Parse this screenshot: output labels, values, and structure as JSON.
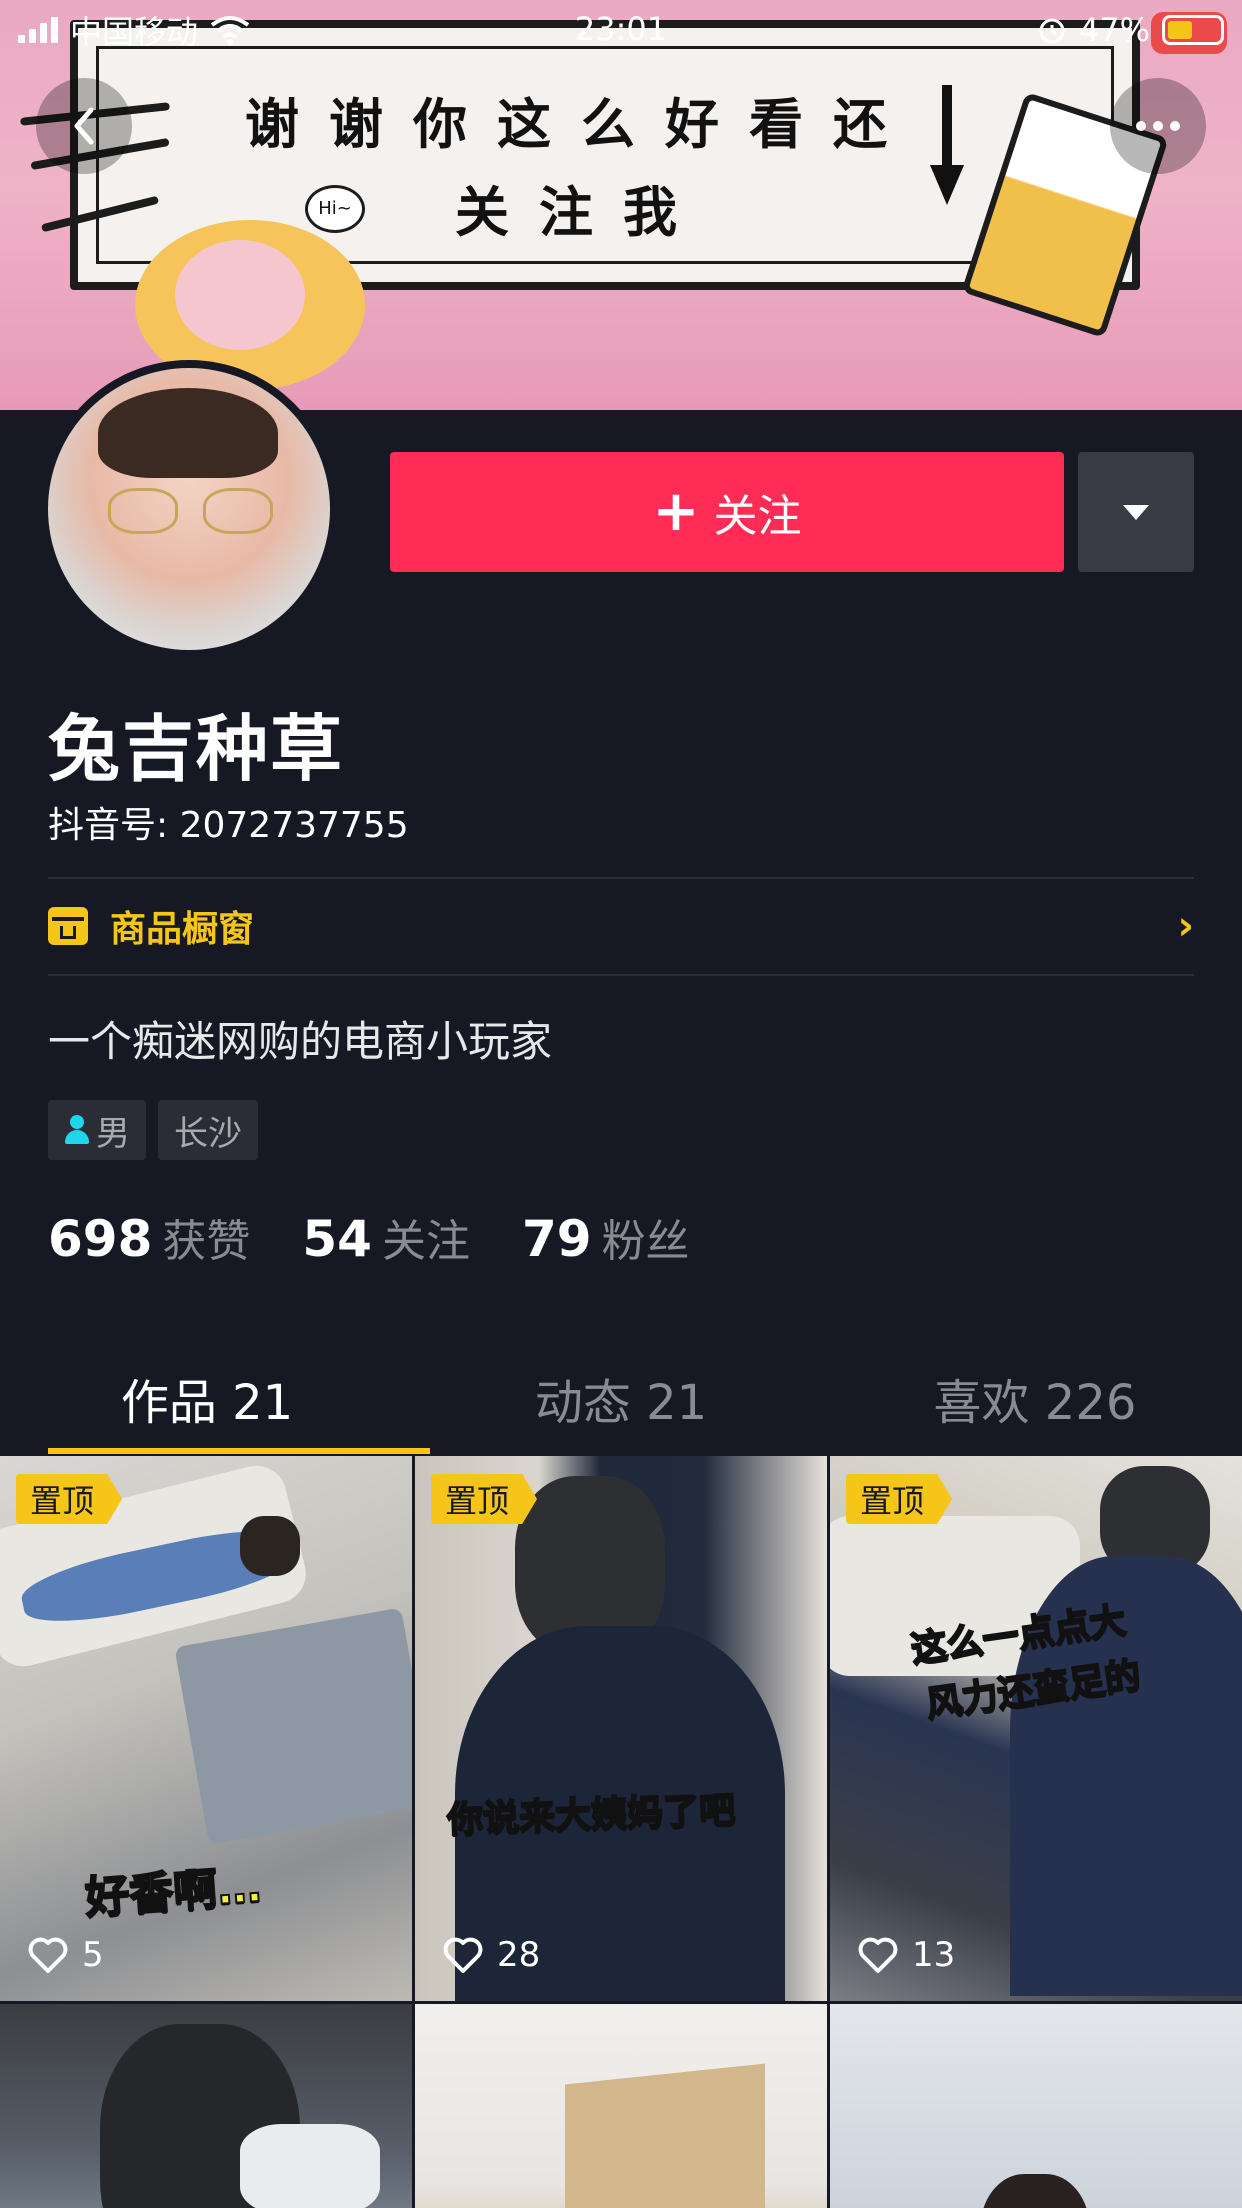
{
  "status_bar": {
    "carrier": "中国移动",
    "time": "23:01",
    "battery_percent": "47%",
    "battery_level": 0.47
  },
  "banner": {
    "line1": "谢谢你这么好看还",
    "line2": "关注我",
    "hi": "Hi~"
  },
  "header": {
    "follow_label": "关注",
    "follow_plus": "+"
  },
  "profile": {
    "name": "兔吉种草",
    "douyin_id": "抖音号: 2072737755",
    "shop_label": "商品橱窗",
    "bio": "一个痴迷网购的电商小玩家",
    "tags": {
      "gender": "男",
      "city": "长沙"
    }
  },
  "stats": {
    "likes_num": "698",
    "likes_label": "获赞",
    "following_num": "54",
    "following_label": "关注",
    "fans_num": "79",
    "fans_label": "粉丝"
  },
  "tabs": [
    {
      "label": "作品 21",
      "active": true
    },
    {
      "label": "动态 21",
      "active": false
    },
    {
      "label": "喜欢 226",
      "active": false
    }
  ],
  "videos": [
    {
      "pinned": "置顶",
      "likes": "5",
      "caption": "好香啊…"
    },
    {
      "pinned": "置顶",
      "likes": "28",
      "caption": "你说来大姨妈了吧"
    },
    {
      "pinned": "置顶",
      "likes": "13",
      "caption_line1": "这么一点点大",
      "caption_line2": "风力还蛮足的"
    }
  ],
  "colors": {
    "background": "#161823",
    "follow_button": "#fe2c55",
    "accent_yellow": "#f5c518",
    "muted_text": "#8a8b91"
  },
  "icons": [
    "back-arrow-icon",
    "more-dots-icon",
    "chevron-down-icon",
    "shop-icon",
    "chevron-right-icon",
    "person-icon",
    "heart-icon",
    "signal-icon",
    "wifi-icon",
    "alarm-icon",
    "battery-icon"
  ]
}
